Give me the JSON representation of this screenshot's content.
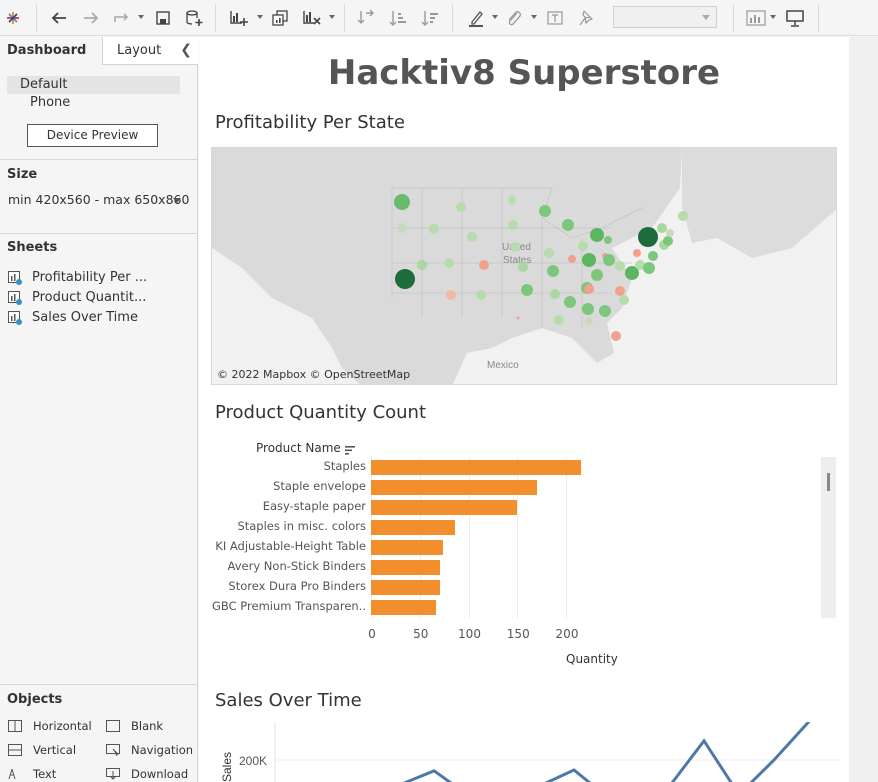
{
  "toolbar": {
    "icons": [
      "tableau-logo-icon",
      "undo-icon",
      "redo-icon",
      "redo-history-icon",
      "save-icon",
      "new-datasource-icon",
      "new-worksheet-icon",
      "duplicate-sheet-icon",
      "clear-sheet-icon",
      "swap-icon",
      "sort-ascending-icon",
      "sort-descending-icon",
      "highlight-icon",
      "group-icon",
      "label-icon",
      "pin-icon",
      "fit-dropdown",
      "show-me-icon",
      "presentation-icon"
    ]
  },
  "left_panel": {
    "tabs": {
      "dashboard": "Dashboard",
      "layout": "Layout"
    },
    "devices": {
      "default": "Default",
      "phone": "Phone"
    },
    "device_preview_button": "Device Preview",
    "size": {
      "title": "Size",
      "value": "min 420x560 - max 650x860"
    },
    "sheets": {
      "title": "Sheets",
      "items": [
        "Profitability Per ...",
        "Product Quantit...",
        "Sales Over Time"
      ]
    },
    "objects": {
      "title": "Objects",
      "items": [
        {
          "label": "Horizontal",
          "icon": "horizontal-container-icon"
        },
        {
          "label": "Blank",
          "icon": "blank-icon"
        },
        {
          "label": "Vertical",
          "icon": "vertical-container-icon"
        },
        {
          "label": "Navigation",
          "icon": "navigation-icon"
        },
        {
          "label": "Text",
          "icon": "text-icon"
        },
        {
          "label": "Download",
          "icon": "download-icon"
        }
      ]
    }
  },
  "dashboard": {
    "title": "Hacktiv8 Superstore",
    "map": {
      "title": "Profitability Per State",
      "labels": {
        "country_us": "United\nStates",
        "country_mx": "Mexico"
      },
      "credit": "© 2022 Mapbox © OpenStreetMap",
      "colors": {
        "strong_profit": "#1e6b3c",
        "profit": "#7cc77c",
        "light_profit": "#b9dfb0",
        "loss": "#f2a08c"
      }
    },
    "bar_chart": {
      "title": "Product Quantity Count",
      "header": "Product Name"
    },
    "sales_chart": {
      "title": "Sales Over Time",
      "ylabel": "Sales",
      "tick_label": "200K"
    }
  },
  "chart_data": [
    {
      "type": "bar",
      "title": "Product Quantity Count",
      "ylabel": "Product Name",
      "xlabel": "Quantity",
      "categories": [
        "Staples",
        "Staple envelope",
        "Easy-staple paper",
        "Staples in misc. colors",
        "KI Adjustable-Height Table",
        "Avery Non-Stick Binders",
        "Storex Dura Pro Binders",
        "GBC Premium Transparen.."
      ],
      "values": [
        215,
        170,
        150,
        86,
        74,
        71,
        71,
        67
      ],
      "xticks": [
        0,
        50,
        100,
        150,
        200
      ],
      "xlim": [
        0,
        235
      ],
      "color": "#f28e2b",
      "grid": true
    },
    {
      "type": "line",
      "title": "Sales Over Time",
      "ylabel": "Sales",
      "yticks": [
        "200K"
      ],
      "values": [
        150000,
        170000,
        186000,
        135000,
        166000,
        187000,
        150000,
        163000,
        165000,
        225000,
        155000,
        200000,
        250000
      ],
      "color": "#4e79a7"
    }
  ]
}
